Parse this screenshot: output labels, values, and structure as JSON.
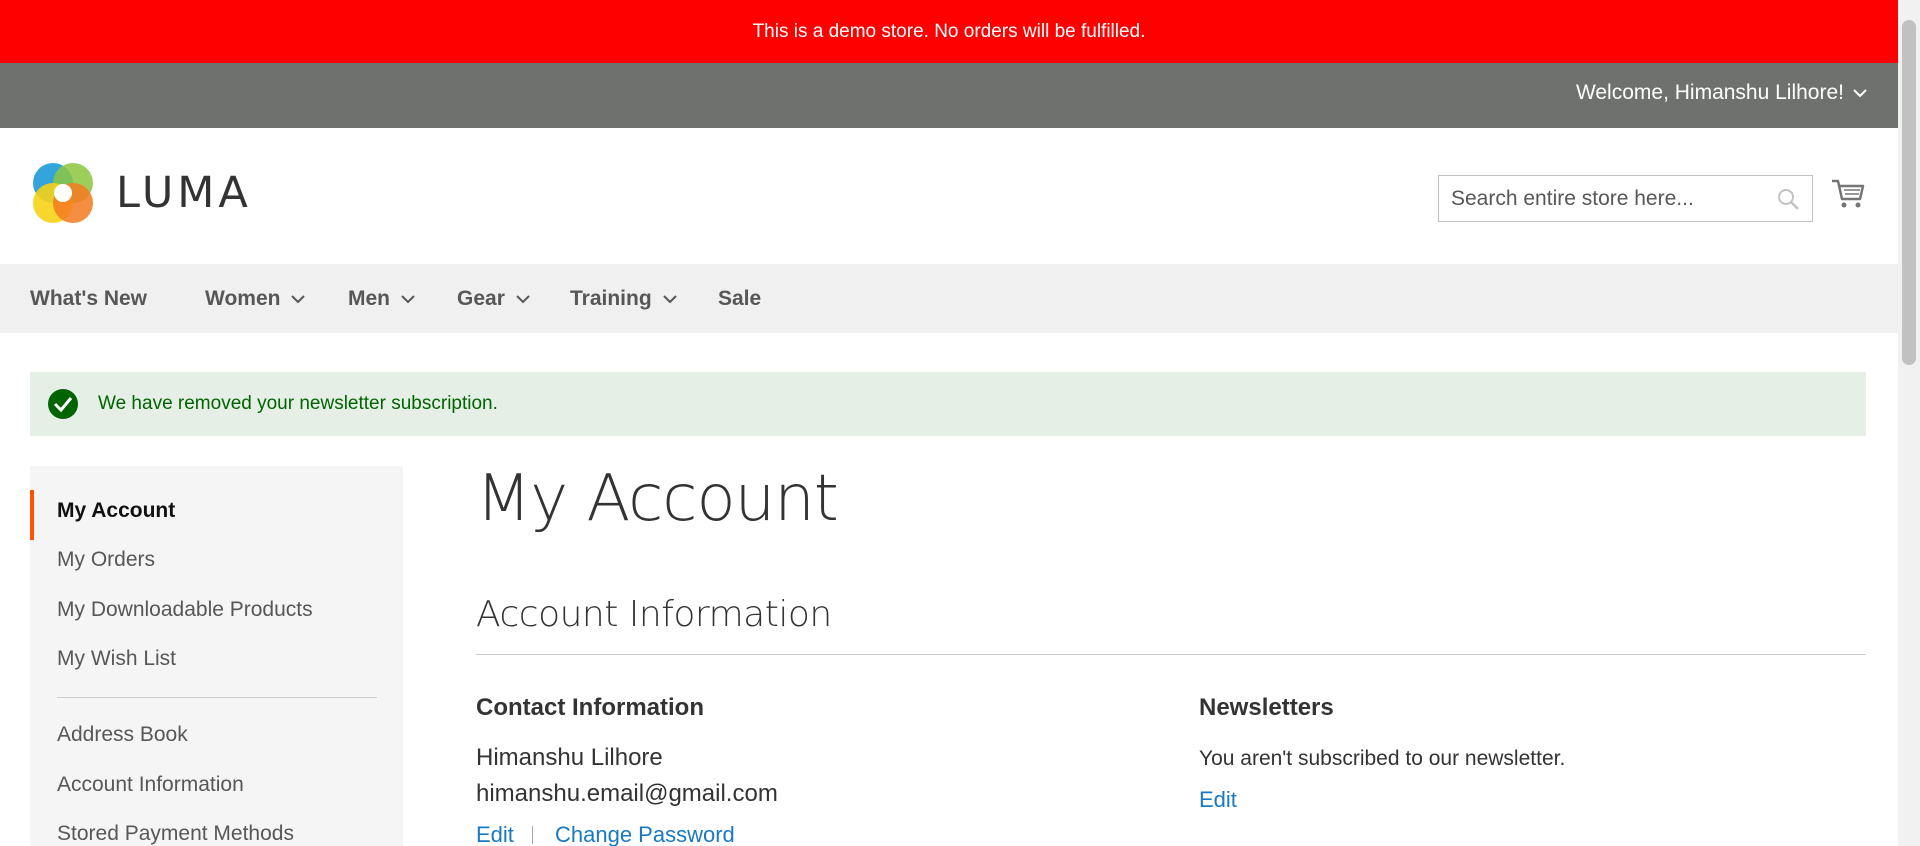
{
  "demo_notice": "This is a demo store. No orders will be fulfilled.",
  "welcome": "Welcome, Himanshu Lilhore!",
  "logo_text": "LUMA",
  "search": {
    "placeholder": "Search entire store here..."
  },
  "nav": [
    "What's New",
    "Women",
    "Men",
    "Gear",
    "Training",
    "Sale"
  ],
  "message": "We have removed your newsletter subscription.",
  "sidebar": {
    "items": [
      "My Account",
      "My Orders",
      "My Downloadable Products",
      "My Wish List",
      "Address Book",
      "Account Information",
      "Stored Payment Methods"
    ]
  },
  "page_title": "My Account",
  "account_info": {
    "title": "Account Information",
    "contact": {
      "title": "Contact Information",
      "name": "Himanshu Lilhore",
      "email": "himanshu.email@gmail.com",
      "edit": "Edit",
      "change_password": "Change Password"
    },
    "newsletters": {
      "title": "Newsletters",
      "status": "You aren't subscribed to our newsletter.",
      "edit": "Edit"
    }
  },
  "colors": {
    "demo_bar": "#ff0000",
    "welcome_bar": "#6e716e",
    "nav_bg": "#f0f0f0",
    "message_bg": "#e5efe5",
    "accent": "#ff5501",
    "link": "#1979c3"
  }
}
